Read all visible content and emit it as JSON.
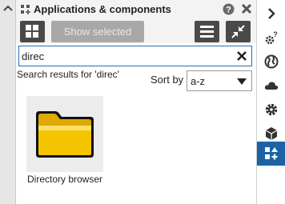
{
  "header": {
    "title": "Applications & components",
    "app_icon": "apps-grid-icon",
    "help_icon": "help-icon",
    "close_icon": "close-icon"
  },
  "toolbar": {
    "show_selected_label": "Show selected",
    "grid_icon": "grid-view-icon",
    "list_icon": "list-view-icon",
    "collapse_icon": "collapse-icon"
  },
  "search": {
    "value": "direc",
    "clear_icon": "clear-icon"
  },
  "results": {
    "label": "Search results for 'direc'",
    "sort_label": "Sort by",
    "sort_value": "a-z"
  },
  "items": [
    {
      "label": "Directory browser",
      "icon": "folder-icon"
    }
  ],
  "right_sidebar": {
    "items": [
      "expand-icon",
      "settings-help-icon",
      "globe-icon",
      "cloud-icon",
      "gear-icon",
      "box-icon",
      "add-apps-icon"
    ],
    "active": "add-apps-icon"
  },
  "colors": {
    "accent": "#1a63a5",
    "search_border": "#1e6fb3",
    "button_dark": "#4a4a4a",
    "button_disabled": "#a8a8a8",
    "folder": "#f5c400"
  }
}
